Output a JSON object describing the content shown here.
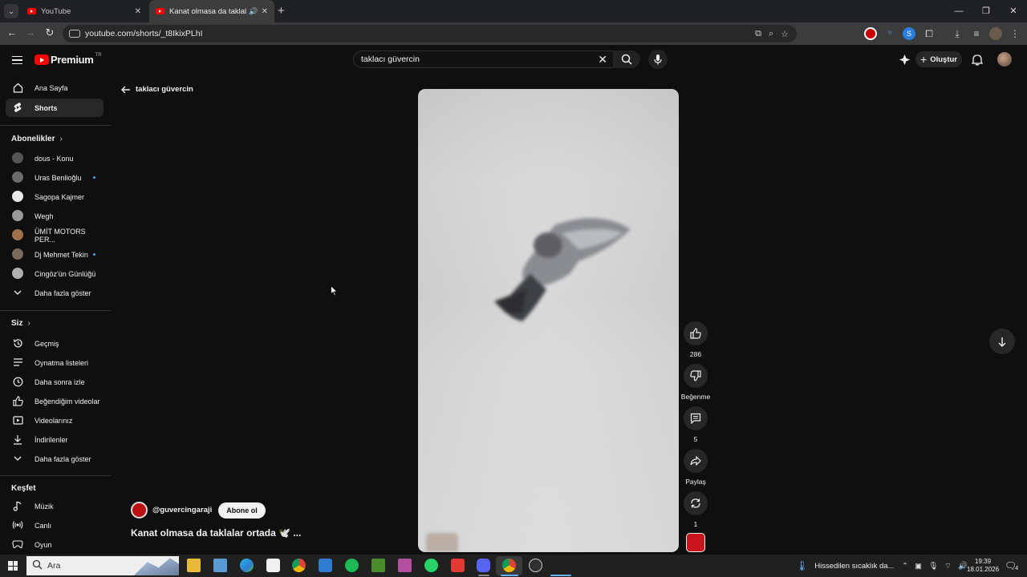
{
  "browser": {
    "tabs": [
      {
        "title": "YouTube"
      },
      {
        "title": "Kanat olmasa da taklalar ortada"
      }
    ],
    "url": "youtube.com/shorts/_t8IkixPLhI",
    "window_controls": [
      "—",
      "❐",
      "✕"
    ]
  },
  "youtube": {
    "logo_text": "Premium",
    "logo_region": "TR",
    "search_query": "taklacı güvercin",
    "create_label": "Oluştur"
  },
  "sidebar": {
    "main": [
      {
        "label": "Ana Sayfa",
        "icon": "home-icon"
      },
      {
        "label": "Shorts",
        "icon": "shorts-icon"
      }
    ],
    "subscriptions_title": "Abonelikler",
    "subscriptions": [
      {
        "label": "dous - Konu",
        "color": "#555555",
        "new": false
      },
      {
        "label": "Uras Benlioğlu",
        "color": "#6b6b6b",
        "new": true
      },
      {
        "label": "Sagopa Kajmer",
        "color": "#e8e8e8",
        "new": false
      },
      {
        "label": "Wegh",
        "color": "#9a9a9a",
        "new": false
      },
      {
        "label": "ÜMİT MOTORS PER...",
        "color": "#a0704a",
        "new": false
      },
      {
        "label": "Dj Mehmet Tekin",
        "color": "#7a6a5a",
        "new": true
      },
      {
        "label": "Cingöz'ün Günlüğü",
        "color": "#b0b0b0",
        "new": false
      }
    ],
    "show_more": "Daha fazla göster",
    "you_title": "Siz",
    "you": [
      {
        "label": "Geçmiş",
        "icon": "history-icon"
      },
      {
        "label": "Oynatma listeleri",
        "icon": "playlists-icon"
      },
      {
        "label": "Daha sonra izle",
        "icon": "watch-later-icon"
      },
      {
        "label": "Beğendiğim videolar",
        "icon": "liked-videos-icon"
      },
      {
        "label": "Videolarınız",
        "icon": "your-videos-icon"
      },
      {
        "label": "İndirilenler",
        "icon": "downloads-icon"
      }
    ],
    "show_more_2": "Daha fazla göster",
    "explore_title": "Keşfet",
    "explore": [
      {
        "label": "Müzik",
        "icon": "music-icon"
      },
      {
        "label": "Canlı",
        "icon": "live-icon"
      },
      {
        "label": "Oyun",
        "icon": "gaming-icon"
      }
    ]
  },
  "short": {
    "back_label": "taklacı güvercin",
    "channel": "@guvercingaraji",
    "subscribe": "Abone ol",
    "title": "Kanat olmasa da taklalar ortada 🕊️ ...",
    "likes": "286",
    "dislike_label": "Beğenme",
    "comments": "5",
    "share_label": "Paylaş",
    "remix_count": "1"
  },
  "taskbar": {
    "search_placeholder": "Ara",
    "weather": "Hissedilen sıcaklık da...",
    "time": "19:39",
    "date": "18.01.2026",
    "notifications": "4"
  }
}
